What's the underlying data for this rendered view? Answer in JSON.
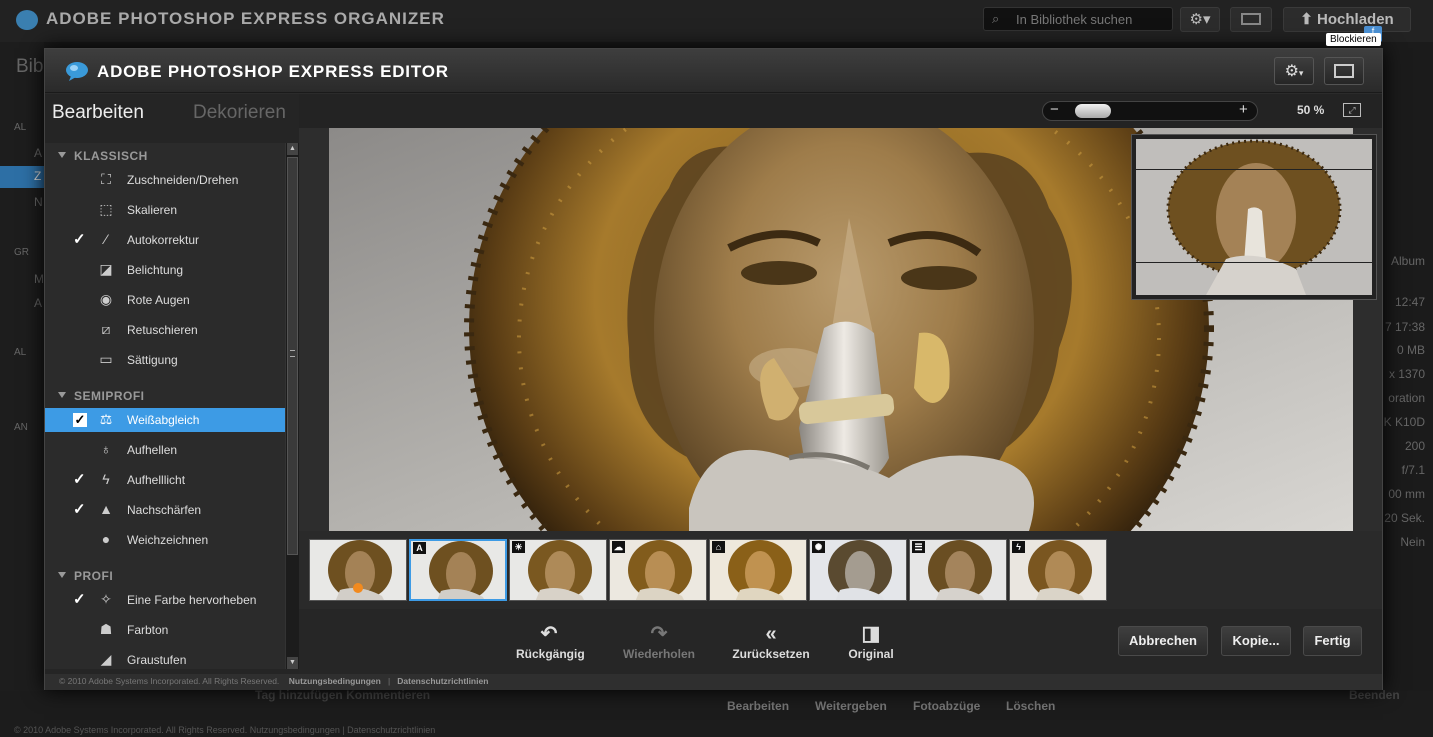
{
  "background": {
    "app_title": "ADOBE PHOTOSHOP EXPRESS ORGANIZER",
    "search_placeholder": "In Bibliothek suchen",
    "upload_label": "Hochladen",
    "block_tooltip": "Blockieren",
    "side_texts": [
      "Bib",
      "AL",
      "A",
      "Z",
      "N",
      "GR",
      "M",
      "A",
      "AL",
      "AN"
    ],
    "right_texts": [
      "Album",
      "12:47",
      "7 17:38",
      "0 MB",
      "x 1370",
      "oration",
      "K K10D",
      "200",
      "f/7.1",
      "00 mm",
      "20 Sek.",
      "Nein"
    ],
    "bottom_actions": [
      "Bearbeiten",
      "Weitergeben",
      "Fotoabzüge",
      "Löschen"
    ],
    "bottom_left": "Tag hinzufügen   Kommentieren",
    "bottom_right": "Beenden",
    "footer": "© 2010 Adobe Systems Incorporated. All Rights Reserved.   Nutzungsbedingungen  |  Datenschutzrichtlinien"
  },
  "editor": {
    "title": "ADOBE PHOTOSHOP EXPRESS EDITOR",
    "tabs": {
      "edit": "Bearbeiten",
      "decorate": "Dekorieren"
    },
    "sections": {
      "classic": "KLASSISCH",
      "semipro": "SEMIPROFI",
      "pro": "PROFI"
    },
    "tools": [
      {
        "label": "Zuschneiden/Drehen",
        "icon": "crop-icon",
        "checked": false
      },
      {
        "label": "Skalieren",
        "icon": "resize-icon",
        "checked": false
      },
      {
        "label": "Autokorrektur",
        "icon": "magic-wand-icon",
        "checked": true
      },
      {
        "label": "Belichtung",
        "icon": "exposure-icon",
        "checked": false
      },
      {
        "label": "Rote Augen",
        "icon": "eye-icon",
        "checked": false
      },
      {
        "label": "Retuschieren",
        "icon": "bandage-icon",
        "checked": false
      },
      {
        "label": "Sättigung",
        "icon": "saturation-icon",
        "checked": false
      },
      {
        "label": "Weißabgleich",
        "icon": "balance-scale-icon",
        "checked": true,
        "selected": true
      },
      {
        "label": "Aufhellen",
        "icon": "lightbulb-icon",
        "checked": false
      },
      {
        "label": "Aufhelllicht",
        "icon": "lightning-icon",
        "checked": true
      },
      {
        "label": "Nachschärfen",
        "icon": "sharpen-icon",
        "checked": true
      },
      {
        "label": "Weichzeichnen",
        "icon": "drop-icon",
        "checked": false
      },
      {
        "label": "Eine Farbe hervorheben",
        "icon": "crosshair-icon",
        "checked": true
      },
      {
        "label": "Farbton",
        "icon": "palette-icon",
        "checked": false
      },
      {
        "label": "Graustufen",
        "icon": "grayscale-icon",
        "checked": false
      }
    ],
    "zoom": {
      "value": "50 %",
      "level": 0.1
    },
    "filmstrip": [
      {
        "badge": "",
        "name": "original"
      },
      {
        "badge": "A",
        "name": "auto"
      },
      {
        "badge": "☀",
        "name": "daylight"
      },
      {
        "badge": "☁",
        "name": "cloudy"
      },
      {
        "badge": "⌂",
        "name": "shade"
      },
      {
        "badge": "✺",
        "name": "tungsten"
      },
      {
        "badge": "☰",
        "name": "fluorescent"
      },
      {
        "badge": "ϟ",
        "name": "flash"
      }
    ],
    "actions": {
      "undo": "Rückgängig",
      "redo": "Wiederholen",
      "reset": "Zurücksetzen",
      "original": "Original"
    },
    "buttons": {
      "cancel": "Abbrechen",
      "copy": "Kopie...",
      "done": "Fertig"
    },
    "footer": {
      "copyright": "© 2010 Adobe Systems Incorporated. All Rights Reserved.",
      "terms": "Nutzungsbedingungen",
      "sep": "|",
      "privacy": "Datenschutzrichtlinien"
    }
  }
}
